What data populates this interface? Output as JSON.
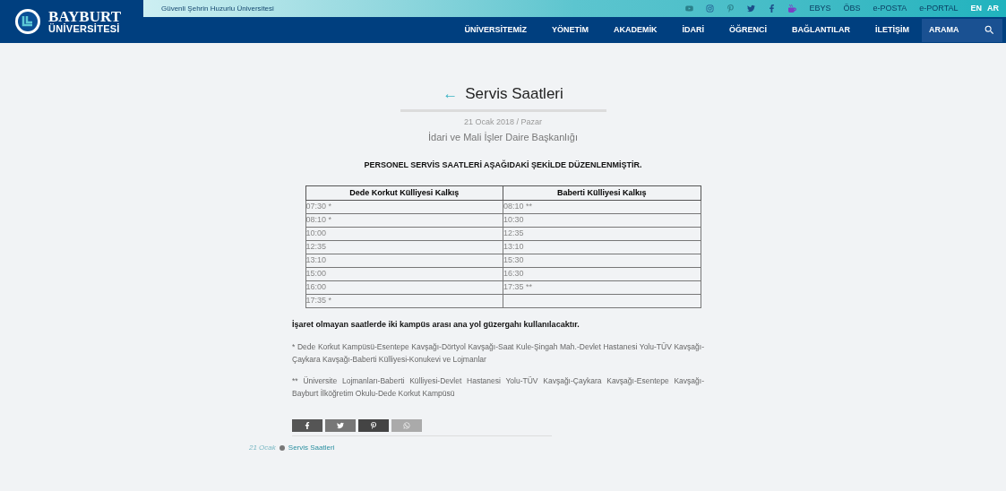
{
  "header": {
    "logo_line1": "BAYBURT",
    "logo_line2": "ÜNİVERSİTESİ",
    "slogan": "Güvenli Şehrin Huzurlu Üniversitesi",
    "top_links": [
      "EBYS",
      "ÖBS",
      "e-POSTA",
      "e-PORTAL"
    ],
    "languages": [
      "EN",
      "AR"
    ],
    "nav": [
      "ÜNİVERSİTEMİZ",
      "YÖNETİM",
      "AKADEMİK",
      "İDARİ",
      "ÖĞRENCİ",
      "BAĞLANTILAR",
      "İLETİŞİM"
    ],
    "search": {
      "label": "ARAMA"
    }
  },
  "article": {
    "back_arrow": "←",
    "title": "Servis Saatleri",
    "date": "21 Ocak 2018 / Pazar",
    "department": "İdari ve Mali İşler Daire Başkanlığı",
    "heading": "PERSONEL SERVİS SAATLERİ AŞAĞIDAKİ ŞEKİLDE DÜZENLENMİŞTİR.",
    "table": {
      "columns": [
        "Dede Korkut Külliyesi Kalkış",
        "Baberti Külliyesi Kalkış"
      ],
      "rows": [
        [
          "07:30 *",
          "08:10 **"
        ],
        [
          "08:10 *",
          "10:30"
        ],
        [
          "10:00",
          "12:35"
        ],
        [
          "12:35",
          "13:10"
        ],
        [
          "13:10",
          "15:30"
        ],
        [
          "15:00",
          "16:30"
        ],
        [
          "16:00",
          "17:35 **"
        ],
        [
          "17:35 *",
          ""
        ]
      ]
    },
    "note": "İşaret olmayan saatlerde iki kampüs arası ana yol güzergahı kullanılacaktır.",
    "routes": [
      "* Dede Korkut Kampüsü-Esentepe Kavşağı-Dörtyol Kavşağı-Saat Kule-Şingah Mah.-Devlet Hastanesi Yolu-TÜV Kavşağı-Çaykara Kavşağı-Baberti Külliyesi-Konukevi ve Lojmanlar",
      "** Üniversite Lojmanları-Baberti Külliyesi-Devlet Hastanesi Yolu-TÜV Kavşağı-Çaykara Kavşağı-Esentepe Kavşağı-Bayburt İlköğretim Okulu-Dede Korkut Kampüsü"
    ]
  },
  "breadcrumb": {
    "date": "21 Ocak",
    "link": "Servis Saatleri"
  }
}
